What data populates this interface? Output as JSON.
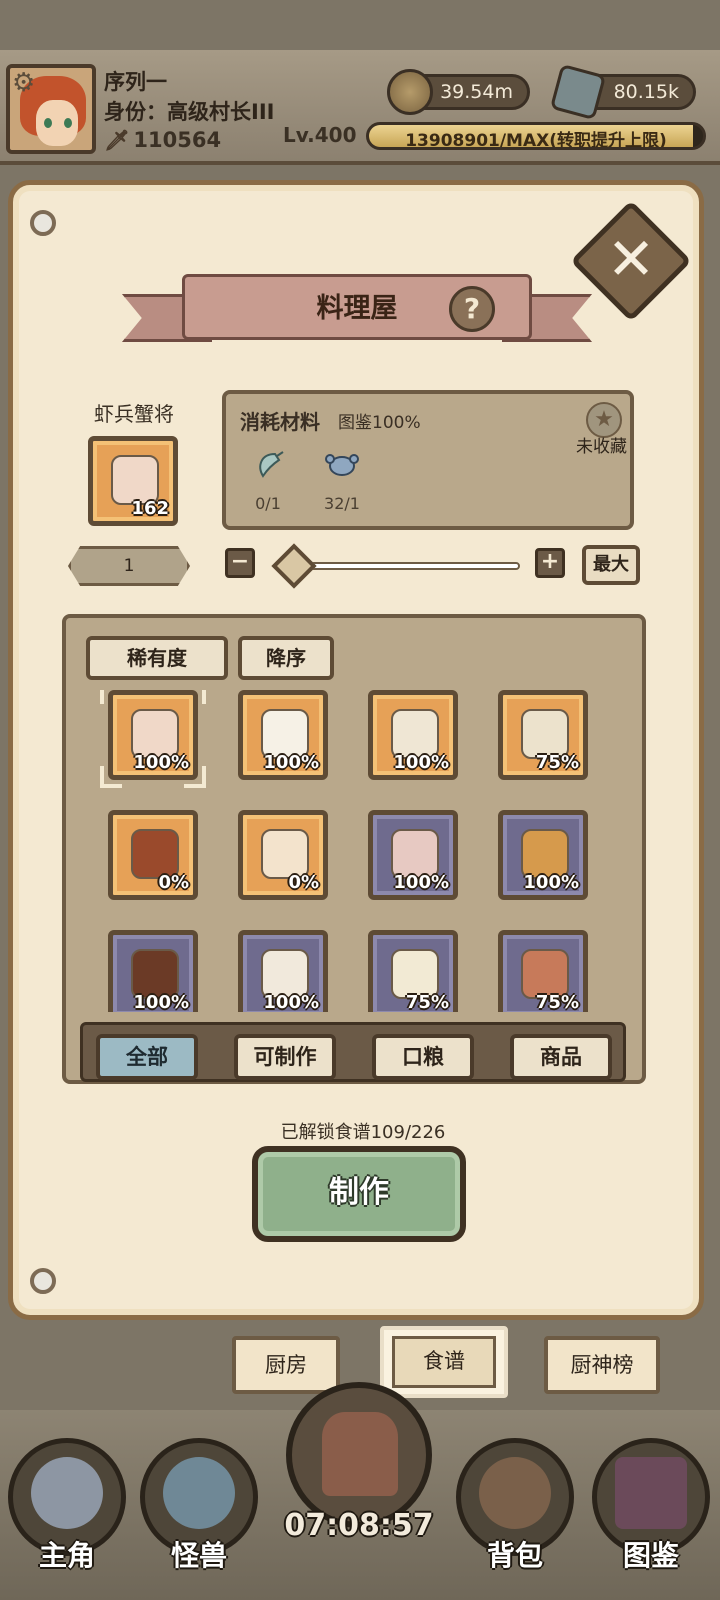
{
  "player": {
    "name": "序列一",
    "title": "身份：高级村长III",
    "power": "110564",
    "level": "Lv.400",
    "exp_text": "13908901/MAX(转职提升上限)",
    "exp_fill": 0.97
  },
  "resources": {
    "coins": "39.54m",
    "ore": "80.15k"
  },
  "panel": {
    "title": "料理屋",
    "help_label": "?",
    "close_label": "✕"
  },
  "selected": {
    "name": "虾兵蟹将",
    "count": "162"
  },
  "materials": {
    "title": "消耗材料",
    "collection": "图鉴100%",
    "favorite_status": "未收藏",
    "items": [
      {
        "icon": "shrimp-icon",
        "count": "0/1"
      },
      {
        "icon": "crab-icon",
        "count": "32/1"
      }
    ]
  },
  "quantity": {
    "value": "1",
    "minus": "−",
    "plus": "+",
    "max_label": "最大",
    "slider_level": 0
  },
  "sort": {
    "rarity_label": "稀有度",
    "order_label": "降序"
  },
  "recipes": [
    {
      "rarity": "orange",
      "pct": "100%",
      "dish": "#f0d8c8",
      "selected": true
    },
    {
      "rarity": "orange",
      "pct": "100%",
      "dish": "#f6f1e6"
    },
    {
      "rarity": "orange",
      "pct": "100%",
      "dish": "#efe6d4"
    },
    {
      "rarity": "orange",
      "pct": "75%",
      "dish": "#ece2cc"
    },
    {
      "rarity": "orange",
      "pct": "0%",
      "dish": "#9a4a2c"
    },
    {
      "rarity": "orange",
      "pct": "0%",
      "dish": "#f3e3cc"
    },
    {
      "rarity": "purple",
      "pct": "100%",
      "dish": "#e7c9c2"
    },
    {
      "rarity": "purple",
      "pct": "100%",
      "dish": "#d69a4c"
    },
    {
      "rarity": "purple",
      "pct": "100%",
      "dish": "#6b3a26"
    },
    {
      "rarity": "purple",
      "pct": "100%",
      "dish": "#f1e9dc"
    },
    {
      "rarity": "purple",
      "pct": "75%",
      "dish": "#f2ead4"
    },
    {
      "rarity": "purple",
      "pct": "75%",
      "dish": "#c77a5a"
    }
  ],
  "filters": [
    {
      "label": "全部",
      "active": true
    },
    {
      "label": "可制作"
    },
    {
      "label": "口粮"
    },
    {
      "label": "商品"
    }
  ],
  "unlock_text": "已解锁食谱109/226",
  "make_label": "制作",
  "tabs": [
    {
      "label": "厨房"
    },
    {
      "label": "食谱",
      "active": true
    },
    {
      "label": "厨神榜"
    }
  ],
  "nav": {
    "hero": "主角",
    "monster": "怪兽",
    "bag": "背包",
    "codex": "图鉴",
    "clock": "07:08:57"
  },
  "colors": {
    "orange_rarity": "#e6a157",
    "purple_rarity": "#6f6b8e",
    "make_button": "#8fb08b",
    "active_filter": "#9cbac4"
  }
}
